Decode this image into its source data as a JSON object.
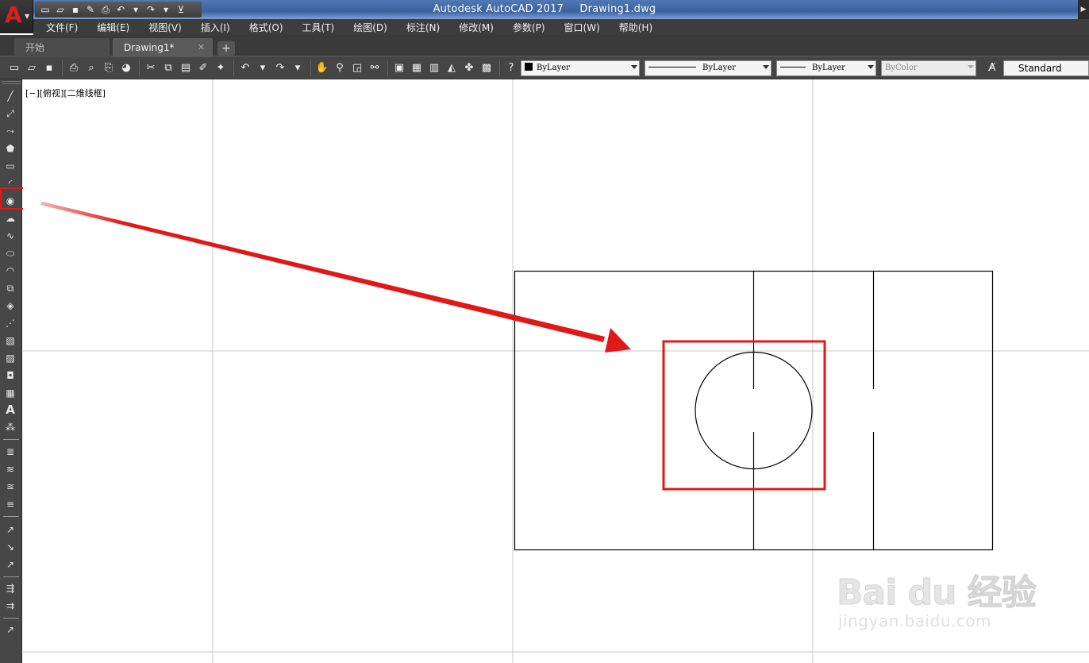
{
  "title_bar": {
    "app_name": "Autodesk AutoCAD 2017",
    "file_name": "Drawing1.dwg",
    "logo_letter": "A"
  },
  "menu": {
    "items": [
      "文件(F)",
      "编辑(E)",
      "视图(V)",
      "插入(I)",
      "格式(O)",
      "工具(T)",
      "绘图(D)",
      "标注(N)",
      "修改(M)",
      "参数(P)",
      "窗口(W)",
      "帮助(H)"
    ]
  },
  "tabs": {
    "start_label": "开始",
    "drawing_label": "Drawing1*",
    "close_glyph": "✕",
    "add_glyph": "+"
  },
  "properties": {
    "color": "ByLayer",
    "linetype": "ByLayer",
    "lineweight": "ByLayer",
    "plot_style": "ByColor",
    "text_style": "Standard"
  },
  "canvas": {
    "viewport_label": "[−][俯视][二维线框]"
  },
  "watermark": {
    "brand": "Bai  du 经验",
    "url": "jingyan.baidu.com"
  },
  "colors": {
    "highlight": "#e01818",
    "arrow": "#e01818",
    "grid": "#c8c8c8",
    "geometry": "#000000"
  },
  "icons": {
    "palette": [
      "line-icon",
      "construction-line-icon",
      "polyline-icon",
      "polygon-icon",
      "rectangle-icon",
      "arc-icon",
      "circle-icon",
      "revision-cloud-icon",
      "spline-icon",
      "ellipse-icon",
      "ellipse-arc-icon",
      "insert-block-icon",
      "make-block-icon",
      "point-icon",
      "hatch-icon",
      "gradient-icon",
      "region-icon",
      "table-icon",
      "multiline-text-icon",
      "add-selected-icon"
    ]
  }
}
